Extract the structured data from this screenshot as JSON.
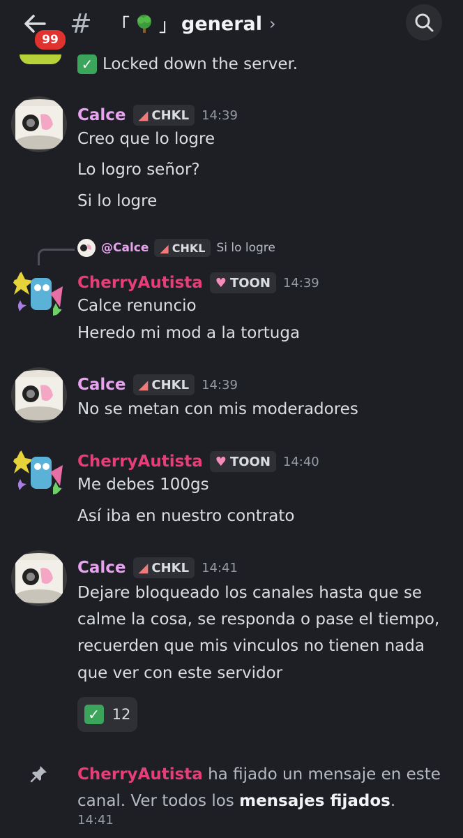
{
  "header": {
    "unread_count": "99",
    "channel_bracket_open": "「",
    "channel_bracket_close": "」",
    "channel_name": "general",
    "chevron": "›"
  },
  "top_message": {
    "text": "Locked down the server."
  },
  "messages": [
    {
      "author": "Calce",
      "tag": "CHKL",
      "time": "14:39",
      "lines": [
        "Creo que lo logre",
        "Lo logro señor?",
        "Si lo logre"
      ]
    },
    {
      "reply_to": {
        "author": "@Calce",
        "tag": "CHKL",
        "text": "Si lo logre"
      },
      "author": "CherryAutista",
      "tag": "TOON",
      "time": "14:39",
      "lines": [
        "Calce renuncio",
        "Heredo mi mod a la tortuga"
      ]
    },
    {
      "author": "Calce",
      "tag": "CHKL",
      "time": "14:39",
      "lines": [
        "No se metan con mis moderadores"
      ]
    },
    {
      "author": "CherryAutista",
      "tag": "TOON",
      "time": "14:40",
      "lines": [
        "Me debes 100gs",
        "Así iba en nuestro contrato"
      ]
    },
    {
      "author": "Calce",
      "tag": "CHKL",
      "time": "14:41",
      "lines": [
        "Dejare bloqueado los canales hasta que se",
        "calme la cosa, se responda o pase el tiempo,",
        "recuerden que mis vinculos no tienen nada",
        "que ver con este servidor"
      ],
      "reaction": {
        "emoji": "✓",
        "count": "12"
      }
    }
  ],
  "pin_notice": {
    "author": "CherryAutista",
    "text_a": " ha fijado un mensaje en este canal. Ver todos los ",
    "link": "mensajes fijados",
    "text_b": ".",
    "time": "14:41"
  },
  "colors": {
    "calce": "#e7a3f0",
    "cherry": "#e63e76",
    "background": "#1e1f24"
  },
  "icons": [
    "back-arrow-icon",
    "hash-icon",
    "tree-emoji-icon",
    "search-icon",
    "pin-icon",
    "check-emoji-icon",
    "meat-emoji-icon",
    "heart-emoji-icon"
  ]
}
